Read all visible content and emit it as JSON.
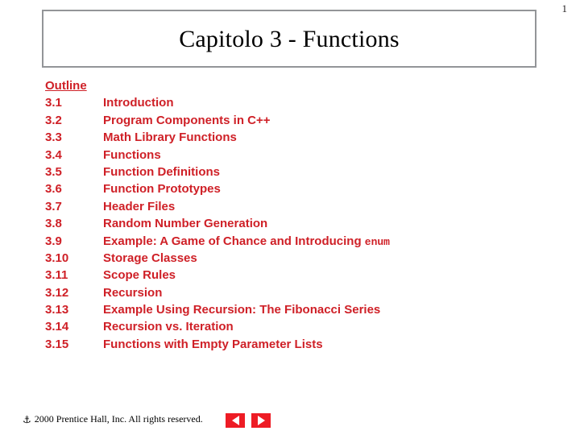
{
  "slide": {
    "page_number": "1",
    "title": "Capitolo 3 - Functions",
    "outline_heading": "Outline",
    "outline_items": [
      {
        "number": "3.1",
        "label": "Introduction",
        "code": ""
      },
      {
        "number": "3.2",
        "label": "Program Components in C++",
        "code": ""
      },
      {
        "number": "3.3",
        "label": "Math Library Functions",
        "code": ""
      },
      {
        "number": "3.4",
        "label": "Functions",
        "code": ""
      },
      {
        "number": "3.5",
        "label": "Function Definitions",
        "code": ""
      },
      {
        "number": "3.6",
        "label": "Function Prototypes",
        "code": ""
      },
      {
        "number": "3.7",
        "label": "Header Files",
        "code": ""
      },
      {
        "number": "3.8",
        "label": "Random Number Generation",
        "code": ""
      },
      {
        "number": "3.9",
        "label": "Example: A Game of Chance and Introducing ",
        "code": "enum"
      },
      {
        "number": "3.10",
        "label": "Storage Classes",
        "code": ""
      },
      {
        "number": "3.11",
        "label": "Scope Rules",
        "code": ""
      },
      {
        "number": "3.12",
        "label": "Recursion",
        "code": ""
      },
      {
        "number": "3.13",
        "label": "Example Using Recursion: The Fibonacci Series",
        "code": ""
      },
      {
        "number": "3.14",
        "label": "Recursion vs. Iteration",
        "code": ""
      },
      {
        "number": "3.15",
        "label": "Functions with Empty Parameter Lists",
        "code": ""
      }
    ]
  },
  "footer": {
    "mark_icon": "copyright-anchor-glyph",
    "mark_glyph": "⚓",
    "text": "2000 Prentice Hall, Inc.  All rights reserved.",
    "back_icon": "triangle-left-icon",
    "forward_icon": "triangle-right-icon"
  },
  "colors": {
    "outline_red": "#cf2027",
    "nav_button_red": "#ee1c25",
    "title_border_gray": "#939598",
    "text_black": "#000000"
  }
}
